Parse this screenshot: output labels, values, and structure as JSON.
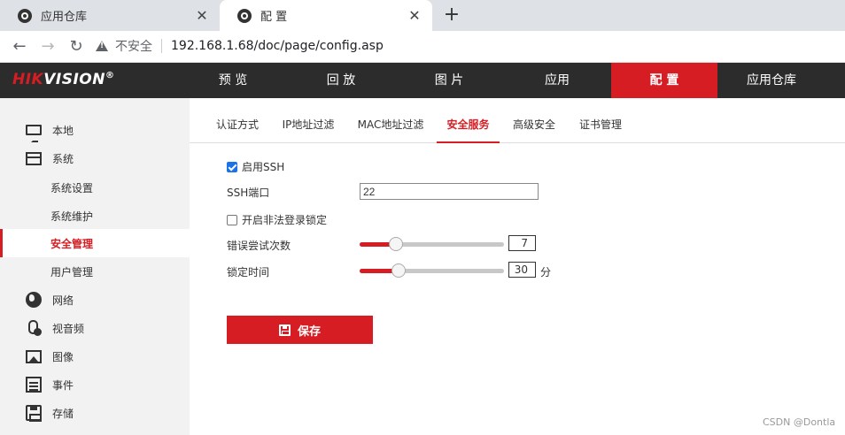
{
  "browser": {
    "tabs": [
      {
        "title": "应用仓库",
        "close": "✕"
      },
      {
        "title": "配 置",
        "close": "✕"
      }
    ],
    "new_tab": "+",
    "nav": {
      "back": "←",
      "forward": "→",
      "reload": "↻"
    },
    "security_label": "不安全",
    "url": "192.168.1.68/doc/page/config.asp"
  },
  "brand": {
    "hik": "HIK",
    "v": "VISION",
    "reg": "®"
  },
  "topnav": [
    {
      "label": "预 览"
    },
    {
      "label": "回 放"
    },
    {
      "label": "图 片"
    },
    {
      "label": "应用"
    },
    {
      "label": "配 置"
    },
    {
      "label": "应用仓库"
    }
  ],
  "sidebar": {
    "items": [
      {
        "label": "本地",
        "icon": "monitor-icon"
      },
      {
        "label": "系统",
        "icon": "window-icon"
      },
      {
        "label": "系统设置"
      },
      {
        "label": "系统维护"
      },
      {
        "label": "安全管理"
      },
      {
        "label": "用户管理"
      },
      {
        "label": "网络",
        "icon": "globe-icon"
      },
      {
        "label": "视音频",
        "icon": "microphone-icon"
      },
      {
        "label": "图像",
        "icon": "image-icon"
      },
      {
        "label": "事件",
        "icon": "calendar-icon"
      },
      {
        "label": "存储",
        "icon": "disk-icon"
      }
    ]
  },
  "subtabs": [
    {
      "label": "认证方式"
    },
    {
      "label": "IP地址过滤"
    },
    {
      "label": "MAC地址过滤"
    },
    {
      "label": "安全服务"
    },
    {
      "label": "高级安全"
    },
    {
      "label": "证书管理"
    }
  ],
  "form": {
    "enable_ssh": {
      "label": "启用SSH",
      "checked": true
    },
    "ssh_port": {
      "label": "SSH端口",
      "value": "22"
    },
    "illegal_login_lock": {
      "label": "开启非法登录锁定",
      "checked": false
    },
    "retry_count": {
      "label": "错误尝试次数",
      "value": "7",
      "level": 0.25
    },
    "lock_time": {
      "label": "锁定时间",
      "value": "30",
      "unit": "分",
      "level": 0.27
    },
    "save_label": "保存"
  },
  "watermark": "CSDN @Dontla",
  "colors": {
    "accent": "#d51d23",
    "navbar": "#2c2c2c",
    "sidebar": "#f2f2f2"
  }
}
